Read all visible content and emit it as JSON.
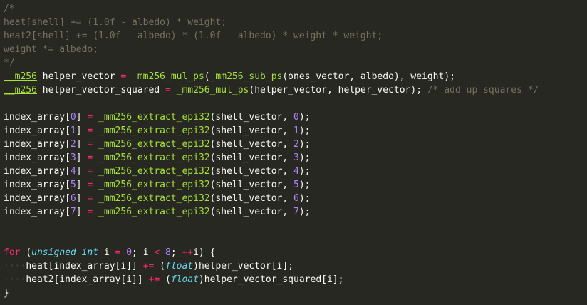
{
  "editor": {
    "colors": {
      "background": "#272822",
      "text": "#f8f8f2",
      "comment": "#75715e",
      "keyword": "#f92672",
      "type": "#66d9ef",
      "function": "#a6e22e",
      "number": "#ae81ff",
      "indent_guide": "#49483e"
    },
    "lines": [
      [
        {
          "t": "/*",
          "c": "comment"
        }
      ],
      [
        {
          "t": "heat[shell] += (1.0f - albedo) * weight;",
          "c": "comment"
        }
      ],
      [
        {
          "t": "heat2[shell] += (1.0f - albedo) * (1.0f - albedo) * weight * weight;  ",
          "c": "comment"
        }
      ],
      [
        {
          "t": "weight *= albedo;",
          "c": "comment"
        }
      ],
      [
        {
          "t": "*/",
          "c": "comment"
        }
      ],
      [
        {
          "t": "__m256",
          "c": "type-u"
        },
        {
          "t": " helper_vector ",
          "c": "id"
        },
        {
          "t": "=",
          "c": "op"
        },
        {
          "t": " ",
          "c": "id"
        },
        {
          "t": "_mm256_mul_ps",
          "c": "fn"
        },
        {
          "t": "(",
          "c": "id"
        },
        {
          "t": "_mm256_sub_ps",
          "c": "fn"
        },
        {
          "t": "(ones_vector, albedo), weight);",
          "c": "id"
        }
      ],
      [
        {
          "t": "__m256",
          "c": "type-u"
        },
        {
          "t": " helper_vector_squared ",
          "c": "id"
        },
        {
          "t": "=",
          "c": "op"
        },
        {
          "t": " ",
          "c": "id"
        },
        {
          "t": "_mm256_mul_ps",
          "c": "fn"
        },
        {
          "t": "(helper_vector, helper_vector); ",
          "c": "id"
        },
        {
          "t": "/* add up squares */",
          "c": "comment"
        }
      ],
      [],
      [
        {
          "t": "index_array[",
          "c": "id"
        },
        {
          "t": "0",
          "c": "num"
        },
        {
          "t": "] ",
          "c": "id"
        },
        {
          "t": "=",
          "c": "op"
        },
        {
          "t": " ",
          "c": "id"
        },
        {
          "t": "_mm256_extract_epi32",
          "c": "fn"
        },
        {
          "t": "(shell_vector, ",
          "c": "id"
        },
        {
          "t": "0",
          "c": "num"
        },
        {
          "t": ");",
          "c": "id"
        }
      ],
      [
        {
          "t": "index_array[",
          "c": "id"
        },
        {
          "t": "1",
          "c": "num"
        },
        {
          "t": "] ",
          "c": "id"
        },
        {
          "t": "=",
          "c": "op"
        },
        {
          "t": " ",
          "c": "id"
        },
        {
          "t": "_mm256_extract_epi32",
          "c": "fn"
        },
        {
          "t": "(shell_vector, ",
          "c": "id"
        },
        {
          "t": "1",
          "c": "num"
        },
        {
          "t": ");",
          "c": "id"
        }
      ],
      [
        {
          "t": "index_array[",
          "c": "id"
        },
        {
          "t": "2",
          "c": "num"
        },
        {
          "t": "] ",
          "c": "id"
        },
        {
          "t": "=",
          "c": "op"
        },
        {
          "t": " ",
          "c": "id"
        },
        {
          "t": "_mm256_extract_epi32",
          "c": "fn"
        },
        {
          "t": "(shell_vector, ",
          "c": "id"
        },
        {
          "t": "2",
          "c": "num"
        },
        {
          "t": ");",
          "c": "id"
        }
      ],
      [
        {
          "t": "index_array[",
          "c": "id"
        },
        {
          "t": "3",
          "c": "num"
        },
        {
          "t": "] ",
          "c": "id"
        },
        {
          "t": "=",
          "c": "op"
        },
        {
          "t": " ",
          "c": "id"
        },
        {
          "t": "_mm256_extract_epi32",
          "c": "fn"
        },
        {
          "t": "(shell_vector, ",
          "c": "id"
        },
        {
          "t": "3",
          "c": "num"
        },
        {
          "t": ");",
          "c": "id"
        }
      ],
      [
        {
          "t": "index_array[",
          "c": "id"
        },
        {
          "t": "4",
          "c": "num"
        },
        {
          "t": "] ",
          "c": "id"
        },
        {
          "t": "=",
          "c": "op"
        },
        {
          "t": " ",
          "c": "id"
        },
        {
          "t": "_mm256_extract_epi32",
          "c": "fn"
        },
        {
          "t": "(shell_vector, ",
          "c": "id"
        },
        {
          "t": "4",
          "c": "num"
        },
        {
          "t": ");",
          "c": "id"
        }
      ],
      [
        {
          "t": "index_array[",
          "c": "id"
        },
        {
          "t": "5",
          "c": "num"
        },
        {
          "t": "] ",
          "c": "id"
        },
        {
          "t": "=",
          "c": "op"
        },
        {
          "t": " ",
          "c": "id"
        },
        {
          "t": "_mm256_extract_epi32",
          "c": "fn"
        },
        {
          "t": "(shell_vector, ",
          "c": "id"
        },
        {
          "t": "5",
          "c": "num"
        },
        {
          "t": ");",
          "c": "id"
        }
      ],
      [
        {
          "t": "index_array[",
          "c": "id"
        },
        {
          "t": "6",
          "c": "num"
        },
        {
          "t": "] ",
          "c": "id"
        },
        {
          "t": "=",
          "c": "op"
        },
        {
          "t": " ",
          "c": "id"
        },
        {
          "t": "_mm256_extract_epi32",
          "c": "fn"
        },
        {
          "t": "(shell_vector, ",
          "c": "id"
        },
        {
          "t": "6",
          "c": "num"
        },
        {
          "t": ");",
          "c": "id"
        }
      ],
      [
        {
          "t": "index_array[",
          "c": "id"
        },
        {
          "t": "7",
          "c": "num"
        },
        {
          "t": "] ",
          "c": "id"
        },
        {
          "t": "=",
          "c": "op"
        },
        {
          "t": " ",
          "c": "id"
        },
        {
          "t": "_mm256_extract_epi32",
          "c": "fn"
        },
        {
          "t": "(shell_vector, ",
          "c": "id"
        },
        {
          "t": "7",
          "c": "num"
        },
        {
          "t": ");",
          "c": "id"
        }
      ],
      [],
      [],
      [
        {
          "t": "for",
          "c": "kw"
        },
        {
          "t": " (",
          "c": "id"
        },
        {
          "t": "unsigned",
          "c": "type"
        },
        {
          "t": " ",
          "c": "id"
        },
        {
          "t": "int",
          "c": "type"
        },
        {
          "t": " i ",
          "c": "id"
        },
        {
          "t": "=",
          "c": "op"
        },
        {
          "t": " ",
          "c": "id"
        },
        {
          "t": "0",
          "c": "num"
        },
        {
          "t": "; i ",
          "c": "id"
        },
        {
          "t": "<",
          "c": "op"
        },
        {
          "t": " ",
          "c": "id"
        },
        {
          "t": "8",
          "c": "num"
        },
        {
          "t": "; ",
          "c": "id"
        },
        {
          "t": "++",
          "c": "op"
        },
        {
          "t": "i) {",
          "c": "id"
        }
      ],
      [
        {
          "t": "····",
          "c": "indent"
        },
        {
          "t": "heat[index_array[i]] ",
          "c": "id"
        },
        {
          "t": "+=",
          "c": "op"
        },
        {
          "t": " (",
          "c": "id"
        },
        {
          "t": "float",
          "c": "type"
        },
        {
          "t": ")helper_vector[i];",
          "c": "id"
        }
      ],
      [
        {
          "t": "····",
          "c": "indent"
        },
        {
          "t": "heat2[index_array[i]] ",
          "c": "id"
        },
        {
          "t": "+=",
          "c": "op"
        },
        {
          "t": " (",
          "c": "id"
        },
        {
          "t": "float",
          "c": "type"
        },
        {
          "t": ")helper_vector_squared[i];",
          "c": "id"
        }
      ],
      [
        {
          "t": "}",
          "c": "id"
        }
      ]
    ]
  }
}
